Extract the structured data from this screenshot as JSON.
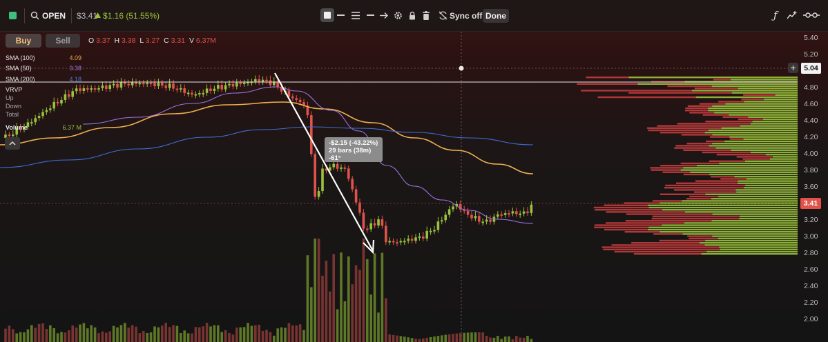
{
  "header": {
    "symbol": "OPEN",
    "price": "$3.41",
    "change": "$1.16 (51.55%)",
    "sync_label": "Sync off",
    "done_label": "Done"
  },
  "trade": {
    "buy_label": "Buy",
    "sell_label": "Sell"
  },
  "ohlcv": {
    "o_label": "O",
    "o": "3.37",
    "h_label": "H",
    "h": "3.38",
    "l_label": "L",
    "l": "3.27",
    "c_label": "C",
    "c": "3.31",
    "v_label": "V",
    "v": "6.37M"
  },
  "indicators": [
    {
      "label": "SMA (100)",
      "value": "4.09",
      "color": "#f0a64a"
    },
    {
      "label": "SMA (50)",
      "value": "3.38",
      "color": "#a07ae6"
    },
    {
      "label": "SMA (200)",
      "value": "4.18",
      "color": "#4a74e0"
    }
  ],
  "vrvp": {
    "title": "VRVP",
    "up": "Up",
    "down": "Down",
    "total": "Total"
  },
  "volume": {
    "label": "Volume",
    "value": "6.37 M"
  },
  "measure": {
    "line1": "-$2.15 (-43.22%)",
    "line2": "29 bars (38m)",
    "line3": "-61°"
  },
  "price_axis": [
    "5.40",
    "5.20",
    "4.80",
    "4.60",
    "4.40",
    "4.20",
    "4.00",
    "3.80",
    "3.60",
    "3.20",
    "3.00",
    "2.80",
    "2.60",
    "2.40",
    "2.20",
    "2.00"
  ],
  "crosshair_price": "5.04",
  "last_price_tag": "3.41",
  "colors": {
    "up": "#9ac23c",
    "down": "#e0534a",
    "accent_green": "#3fbf7f"
  },
  "icons": [
    "app-icon",
    "search-icon",
    "triangle-up-icon",
    "rectangle-tool-icon",
    "horizontal-line-icon",
    "lines-icon",
    "line-tool-icon",
    "arrow-tool-icon",
    "gear-icon",
    "lock-icon",
    "trash-icon",
    "sync-icon",
    "function-icon",
    "trend-icon",
    "compare-icon",
    "plus-icon",
    "collapse-icon"
  ]
}
